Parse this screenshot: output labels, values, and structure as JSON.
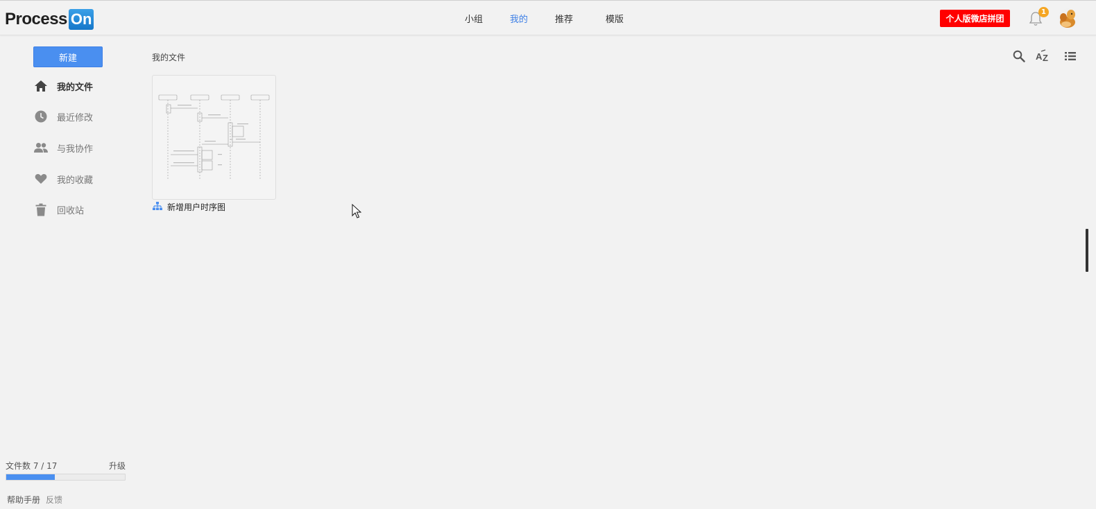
{
  "header": {
    "logo_process": "Process",
    "logo_on": "On",
    "nav": [
      "小组",
      "我的",
      "推荐",
      "模版"
    ],
    "active_nav": "我的",
    "promo_label": "个人版微店拼团",
    "notification_count": "1",
    "accent_color": "#3d7fe6",
    "promo_color": "#ff0000",
    "badge_color": "#f5a623"
  },
  "sidebar": {
    "new_label": "新建",
    "items": [
      {
        "label": "我的文件",
        "icon": "home-icon",
        "active": true
      },
      {
        "label": "最近修改",
        "icon": "clock-icon",
        "active": false
      },
      {
        "label": "与我协作",
        "icon": "people-icon",
        "active": false
      },
      {
        "label": "我的收藏",
        "icon": "heart-icon",
        "active": false
      },
      {
        "label": "回收站",
        "icon": "trash-icon",
        "active": false
      }
    ],
    "stats_label": "文件数 7 / 17",
    "files_used": 7,
    "files_limit": 17,
    "upgrade_label": "升级",
    "help_label": "帮助手册",
    "feedback_label": "反馈"
  },
  "main": {
    "breadcrumb": "我的文件",
    "toolbar": [
      "search-icon",
      "sort-az-icon",
      "list-view-icon"
    ],
    "files": [
      {
        "name": "新增用户时序图",
        "type_icon": "org-chart-icon"
      }
    ]
  }
}
